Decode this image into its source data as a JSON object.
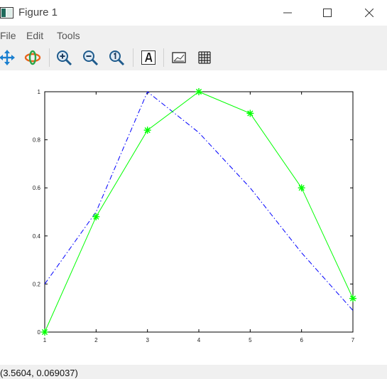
{
  "window": {
    "title": "Figure 1"
  },
  "menu": {
    "items": [
      "File",
      "Edit",
      "Tools"
    ]
  },
  "toolbar": {
    "tools": [
      "pan-icon",
      "rotate-icon",
      "zoom-in-icon",
      "zoom-out-icon",
      "zoom-reset-icon",
      "insert-text-icon",
      "toggle-axes-icon",
      "toggle-grid-icon"
    ]
  },
  "status": {
    "coordinates": "(3.5604, 0.069037)"
  },
  "colors": {
    "series_dashdot": "#0000ff",
    "series_stars": "#00ff00",
    "chrome": "#f0f0f0"
  },
  "chart_data": {
    "type": "line",
    "xlim": [
      1,
      7
    ],
    "ylim": [
      0,
      1
    ],
    "xticks": [
      1,
      2,
      3,
      4,
      5,
      6,
      7
    ],
    "yticks": [
      0,
      0.2,
      0.4,
      0.6,
      0.8,
      1
    ],
    "xtick_labels": [
      "1",
      "2",
      "3",
      "4",
      "5",
      "6",
      "7"
    ],
    "ytick_labels": [
      "0",
      "0.2",
      "0.4",
      "0.6",
      "0.8",
      "1"
    ],
    "grid": false,
    "series": [
      {
        "x": [
          1,
          2,
          3,
          4,
          5,
          6,
          7
        ],
        "values": [
          0.2,
          0.5,
          1.0,
          0.83,
          0.6,
          0.33,
          0.09
        ],
        "color": "#0000ff",
        "line_style": "dash-dot",
        "marker": "none"
      },
      {
        "x": [
          1,
          2,
          3,
          4,
          5,
          6,
          7
        ],
        "values": [
          0.0,
          0.48,
          0.84,
          1.0,
          0.91,
          0.6,
          0.14
        ],
        "color": "#00ff00",
        "line_style": "solid",
        "marker": "asterisk"
      }
    ]
  }
}
